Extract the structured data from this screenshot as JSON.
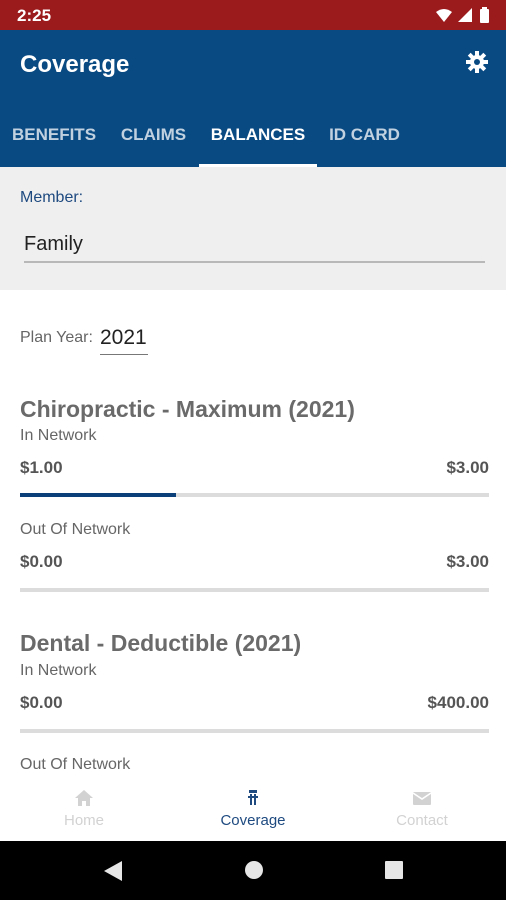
{
  "status_bar": {
    "time": "2:25"
  },
  "app_bar": {
    "title": "Coverage",
    "tabs": [
      {
        "label": "BENEFITS"
      },
      {
        "label": "CLAIMS"
      },
      {
        "label": "BALANCES"
      },
      {
        "label": "ID CARD"
      }
    ],
    "active_tab": "BALANCES"
  },
  "member": {
    "label": "Member:",
    "value": "Family"
  },
  "plan_year": {
    "label": "Plan Year:",
    "value": "2021"
  },
  "sections": [
    {
      "title": "Chiropractic - Maximum (2021)",
      "in_network": {
        "label": "In Network",
        "used": "$1.00",
        "max": "$3.00",
        "fraction": 0.333
      },
      "out_network": {
        "label": "Out Of Network",
        "used": "$0.00",
        "max": "$3.00",
        "fraction": 0
      }
    },
    {
      "title": "Dental - Deductible (2021)",
      "in_network": {
        "label": "In Network",
        "used": "$0.00",
        "max": "$400.00",
        "fraction": 0
      },
      "out_network": {
        "label": "Out Of Network"
      }
    }
  ],
  "bottom_nav": [
    {
      "label": "Home",
      "icon": "home-icon"
    },
    {
      "label": "Coverage",
      "icon": "coverage-icon"
    },
    {
      "label": "Contact",
      "icon": "mail-icon"
    }
  ],
  "active_nav": "Coverage",
  "colors": {
    "status_bar": "#9b1b1d",
    "app_bar": "#0a4a83",
    "accent": "#1e4a80",
    "progress_fill": "#0a3f7a"
  }
}
